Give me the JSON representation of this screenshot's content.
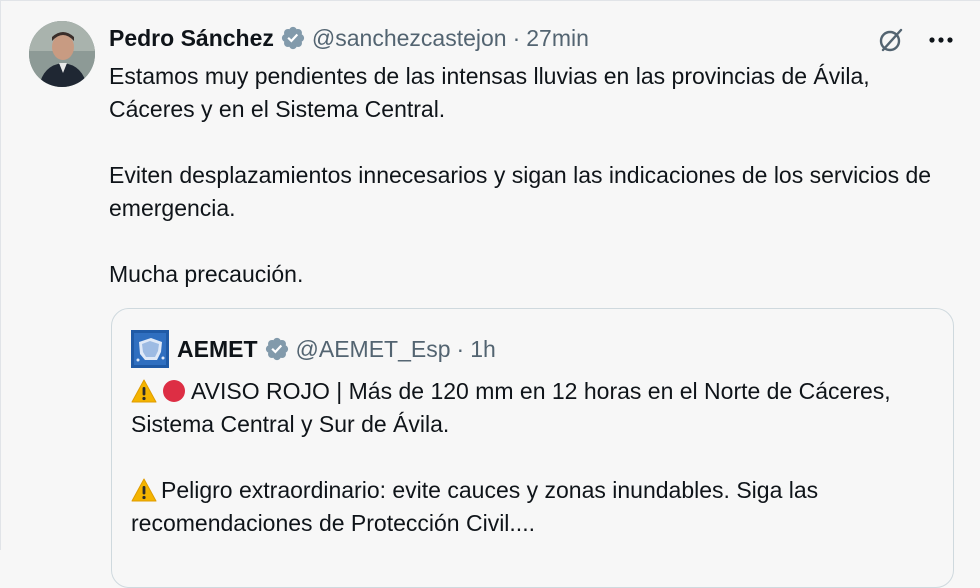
{
  "tweet": {
    "author_name": "Pedro Sánchez",
    "handle": "@sanchezcastejon",
    "separator": "·",
    "time": "27min",
    "more_label": "···",
    "paragraphs": [
      "Estamos muy pendientes de las intensas lluvias en las provincias de Ávila, Cáceres y en el Sistema Central.",
      "Eviten desplazamientos innecesarios y sigan las indicaciones de los servicios de emergencia.",
      "Mucha precaución."
    ]
  },
  "quote": {
    "author_name": "AEMET",
    "handle": "@AEMET_Esp",
    "separator": "·",
    "time": "1h",
    "line1_emojis": [
      "warning-emoji",
      "red-circle-emoji"
    ],
    "line1_text": "AVISO ROJO | Más de 120 mm en 12 horas en el Norte de Cáceres, Sistema Central y Sur de Ávila.",
    "line2_emojis": [
      "warning-emoji"
    ],
    "line2_text": "Peligro extraordinario: evite cauces y zonas inundables. Siga las recomendaciones de Protección Civil...."
  },
  "icons": {
    "verified": "verified-badge-icon",
    "grok": "grok-icon",
    "more": "more-icon"
  },
  "colors": {
    "verified_badge": "#829aab",
    "muted_text": "#536471",
    "warning": "#f4b400",
    "red_circle": "#dd2e44",
    "background": "#f7f7f7"
  }
}
